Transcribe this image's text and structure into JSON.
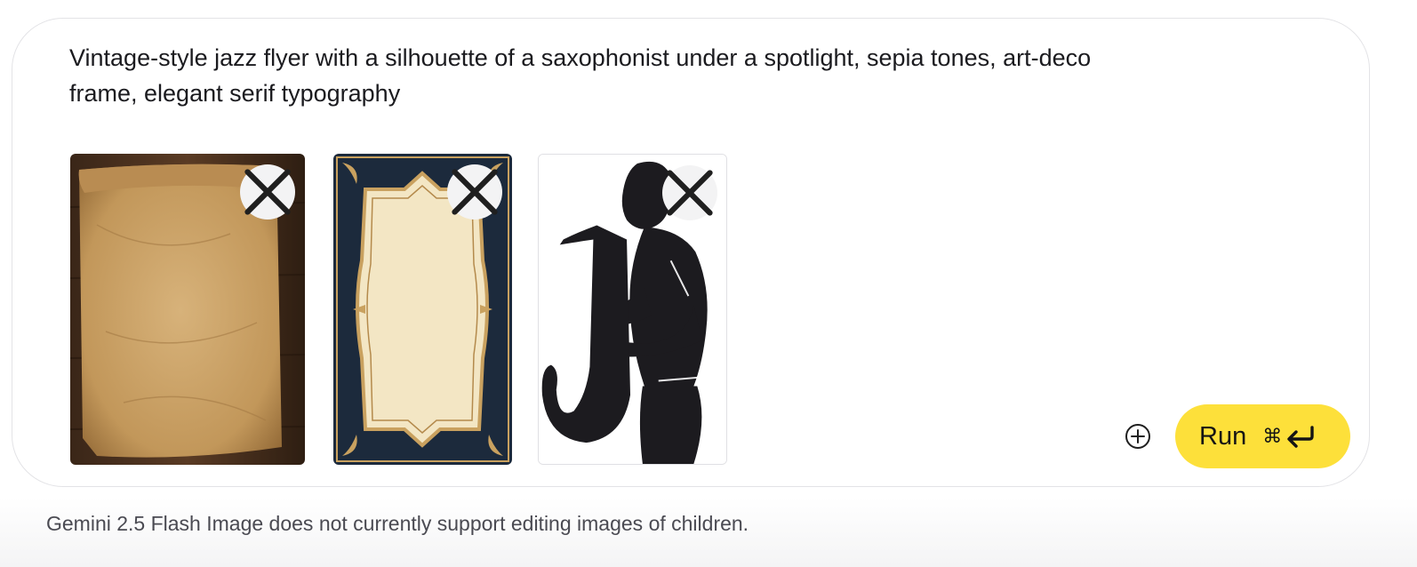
{
  "prompt": {
    "text": "Vintage-style jazz flyer with a silhouette of a saxophonist under a spotlight, sepia tones, art-deco frame, elegant serif typography"
  },
  "attachments": [
    {
      "name": "aged-paper-image",
      "remove_icon": "close-icon"
    },
    {
      "name": "art-deco-frame-image",
      "remove_icon": "close-icon"
    },
    {
      "name": "saxophonist-silhouette-image",
      "remove_icon": "close-icon"
    }
  ],
  "actions": {
    "add_icon": "add-circle-icon",
    "run_label": "Run",
    "run_shortcut_cmd": "⌘",
    "run_shortcut_icon": "enter-arrow-icon",
    "run_color": "#fde03a"
  },
  "footer": {
    "disclaimer": "Gemini 2.5 Flash Image does not currently support editing images of children."
  }
}
